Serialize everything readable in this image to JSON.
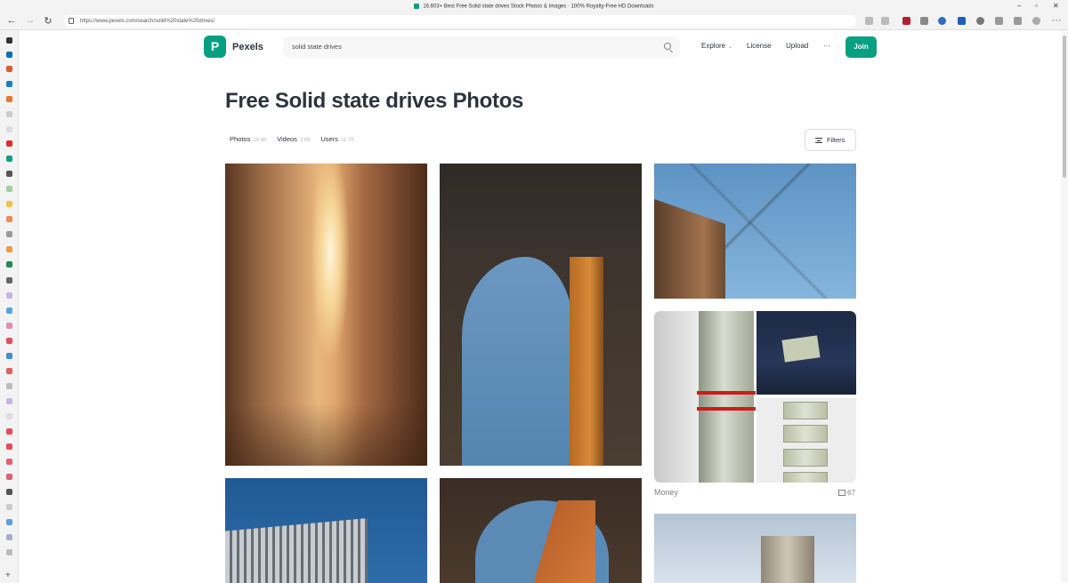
{
  "browser": {
    "window_title": "16,603+ Best Free Solid state drives Stock Photos & Images · 100% Royalty-Free HD Downloads",
    "url": "https://www.pexels.com/search/solid%20state%20drives/"
  },
  "header": {
    "brand": "Pexels",
    "search_value": "solid state drives",
    "nav": {
      "explore": "Explore",
      "license": "License",
      "upload": "Upload",
      "more": "···"
    },
    "join": "Join"
  },
  "main": {
    "title": "Free Solid state drives Photos",
    "tabs": [
      {
        "label": "Photos",
        "count": "16.6K"
      },
      {
        "label": "Videos",
        "count": "3.6K"
      },
      {
        "label": "Users",
        "count": "11.7K"
      }
    ],
    "filters": "Filters"
  },
  "collection": {
    "label": "Money",
    "count": "67"
  },
  "colors": {
    "brand": "#05a081",
    "text": "#2c343e"
  }
}
